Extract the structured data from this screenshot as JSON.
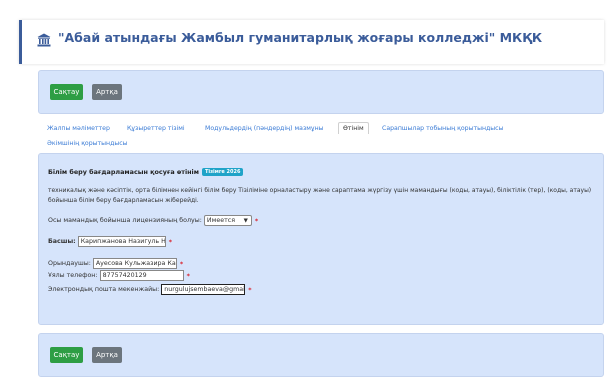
{
  "header": {
    "icon": "bank-icon",
    "title": "\"Абай атындағы Жамбыл гуманитарлық жоғары колледжі\" МКҚК"
  },
  "toolbar_top": {
    "save_label": "Сақтау",
    "back_label": "Артқа"
  },
  "toolbar_bottom": {
    "save_label": "Сақтау",
    "back_label": "Артқа"
  },
  "tabs": [
    {
      "label": "Жалпы мәліметтер",
      "active": false
    },
    {
      "label": "Құзыреттер тізімі",
      "active": false
    },
    {
      "label": "Модульдердің (пәндердің) мазмұны",
      "active": false
    },
    {
      "label": "Өтінім",
      "active": true
    },
    {
      "label": "Сарапшылар тобының қорытындысы",
      "active": false
    },
    {
      "label": "Әкімшінің қорытындысы",
      "active": false
    }
  ],
  "form": {
    "title": "Білім беру бағдарламасын қосуға өтінім",
    "badge": "Тізімге 2026",
    "description": "техникалық және кәсіптік, орта білімнен кейінгі білім беру Тізіліміне орналастыру және сараптама жүргізу үшін мамандығы (коды, атауы), біліктілік (тер), (коды, атауы) бойынша білім беру бағдарламасын жіберейді.",
    "license_label": "Осы мамандық бойынша лицензияның болуы:",
    "license_value": "Имеется",
    "head_label": "Басшы:",
    "head_value": "Карипжанова Назигуль Н",
    "executor_label": "Орындаушы:",
    "executor_value": "Ауесова Кульжазира Кан",
    "phone_label": "Ұялы телефон:",
    "phone_value": "87757420129",
    "email_label": "Электрондық пошта мекенжайы:",
    "email_value": "nurgulujsembaeva@gmai",
    "required_mark": "*"
  }
}
